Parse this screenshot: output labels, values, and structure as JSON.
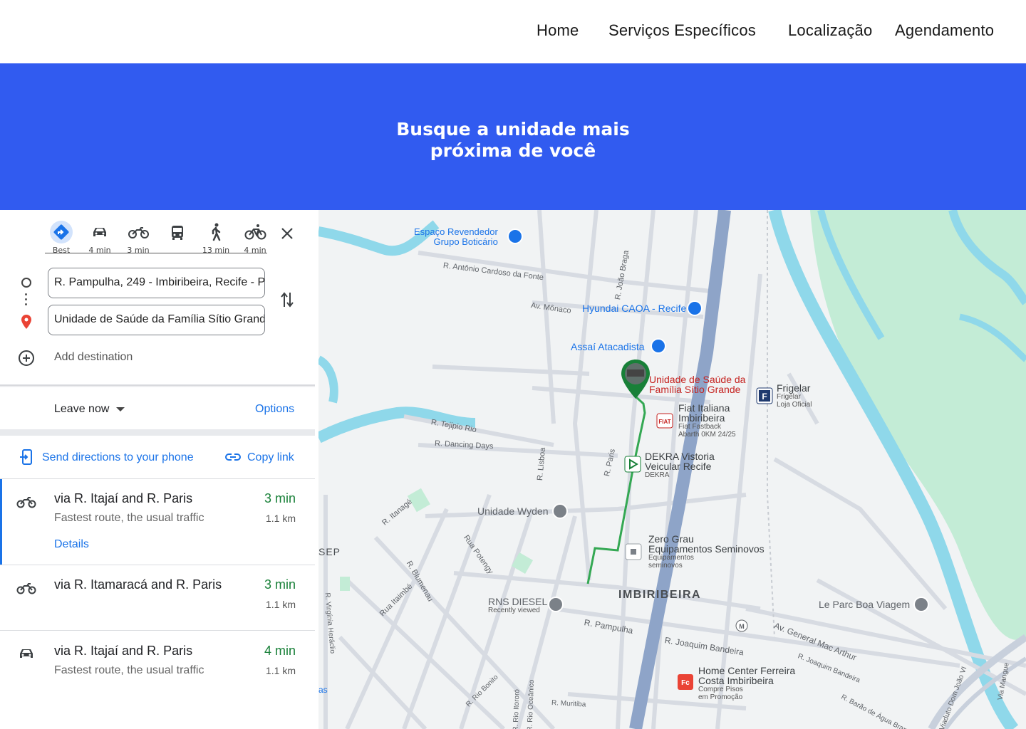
{
  "nav": {
    "home": "Home",
    "services": "Serviços Específicos",
    "location": "Localização",
    "booking": "Agendamento"
  },
  "hero": {
    "title_line1": "Busque a unidade mais",
    "title_line2": "próxima de você",
    "background_color": "#315bf0"
  },
  "directions": {
    "modes": [
      {
        "name": "best",
        "label": "Best",
        "icon": "directions-diamond-icon"
      },
      {
        "name": "car",
        "label": "4 min",
        "icon": "car-icon"
      },
      {
        "name": "motorcycle",
        "label": "3 min",
        "icon": "motorcycle-icon"
      },
      {
        "name": "transit",
        "label": "",
        "icon": "bus-icon"
      },
      {
        "name": "walk",
        "label": "13 min",
        "icon": "walk-icon"
      },
      {
        "name": "bike",
        "label": "4 min",
        "icon": "bicycle-icon"
      }
    ],
    "origin": "R. Pampulha, 249 - Imbiribeira, Recife - P",
    "destination": "Unidade de Saúde da Família Sítio Grand",
    "add_destination": "Add destination",
    "leave_now": "Leave now",
    "options": "Options",
    "send_to_phone": "Send directions to your phone",
    "copy_link": "Copy link",
    "routes": [
      {
        "via": "via R. Itajaí and R. Paris",
        "time": "3 min",
        "desc": "Fastest route, the usual traffic",
        "distance": "1.1 km",
        "details": "Details",
        "mode_icon": "motorcycle-icon"
      },
      {
        "via": "via R. Itamaracá and R. Paris",
        "time": "3 min",
        "desc": "",
        "distance": "1.1 km",
        "mode_icon": "motorcycle-icon"
      },
      {
        "via": "via R. Itajaí and R. Paris",
        "time": "4 min",
        "desc": "Fastest route, the usual traffic",
        "distance": "1.1 km",
        "mode_icon": "car-icon"
      }
    ]
  },
  "map": {
    "places": {
      "boticario_1": "Espaço Revendedor",
      "boticario_2": "Grupo Boticário",
      "hyundai": "Hyundai CAOA - Recife",
      "assai": "Assaí Atacadista",
      "usf_1": "Unidade de Saúde da",
      "usf_2": "Família Sítio Grande",
      "frigelar_1": "Frigelar",
      "frigelar_2": "Frigelar",
      "frigelar_3": "Loja Oficial",
      "fiat_1": "Fiat Italiana",
      "fiat_2": "Imbiribeira",
      "fiat_3": "Fiat Fastback",
      "fiat_4": "Abarth 0KM 24/25",
      "dekra_1": "DEKRA Vistoria",
      "dekra_2": "Veicular Recife",
      "dekra_3": "DEKRA",
      "wyden": "Unidade Wyden",
      "zerograu_1": "Zero Grau",
      "zerograu_2": "Equipamentos Seminovos",
      "zerograu_3": "Equipamentos",
      "zerograu_4": "seminovos",
      "rns_1": "RNS DIESEL",
      "rns_2": "Recently viewed",
      "neighborhood": "IMBIRIBEIRA",
      "leparc": "Le Parc Boa Viagem",
      "homecenter_1": "Home Center Ferreira",
      "homecenter_2": "Costa Imbiribeira",
      "homecenter_3": "Compre Pisos",
      "homecenter_4": "em Promoção",
      "sep": "SEP",
      "edge_as": "as"
    },
    "streets": {
      "antonio_cardoso": "R. Antônio Cardoso da Fonte",
      "joao_braga": "R. João Braga",
      "av_monaco": "Av. Mônaco",
      "tejipio": "R. Tejipio Rio",
      "dancing_days": "R. Dancing Days",
      "lisboa": "R. Lisboa",
      "paris": "R. Paris",
      "itanage": "R. Itanagé",
      "potengy": "Rua Potengy",
      "blumenau": "R. Blumenau",
      "itaimbe": "Rua Itaimbé",
      "virginia": "R. Virgínia Heráclio",
      "pampulha": "R. Pampulha",
      "joaquim_bandeira": "R. Joaquim Bandeira",
      "mac_arthur": "Av. General Mac Arthur",
      "joaquim_bandeira_2": "R. Joaquim Bandeira",
      "barao": "R. Barão de Água Branca",
      "rio_bonito": "R. Rio Bonito",
      "rio_itororo": "R. Rio Itororó",
      "rio_oceanico": "R. Rio Oceânico",
      "muritiba": "R. Muritiba",
      "dom_joao": "Viaduto Dom João VI",
      "via_mangue": "Via Mangue"
    },
    "colors": {
      "water": "#8fd8ea",
      "park": "#c3ecd6",
      "route": "#34a853",
      "highway": "#8ea4c8",
      "poi_blue": "#1a73e8",
      "poi_red": "#c5221f"
    }
  }
}
